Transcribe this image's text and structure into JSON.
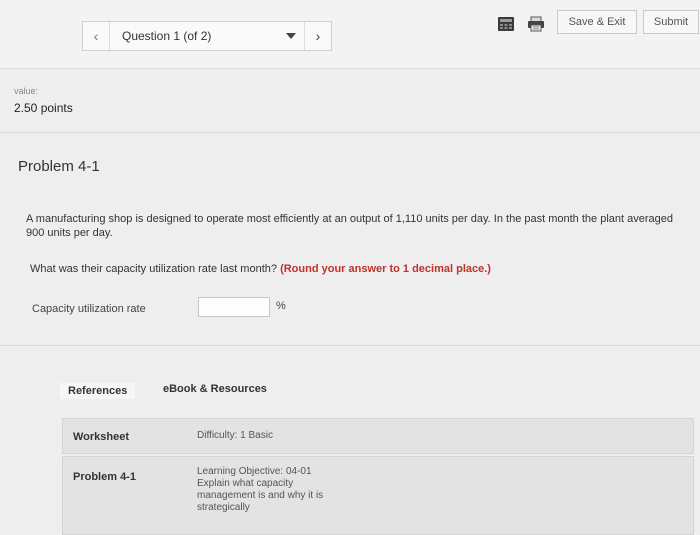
{
  "header": {
    "question_selector": "Question 1 (of 2)",
    "save_exit_label": "Save & Exit",
    "submit_label": "Submit",
    "icons": [
      "calculator-icon",
      "print-icon"
    ]
  },
  "score": {
    "label": "value:",
    "points": "2.50 points"
  },
  "problem": {
    "title": "Problem 4-1",
    "text": "A manufacturing shop is designed to operate most efficiently at an output of 1,110 units per day. In the past month the plant averaged 900 units per day.",
    "prompt": "What was their capacity utilization rate last month?",
    "hint": "(Round your answer to 1 decimal place.)",
    "input_label": "Capacity utilization rate",
    "input_value": "",
    "unit": "%"
  },
  "tabs": {
    "references": "References",
    "ebook": "eBook & Resources"
  },
  "rows": [
    {
      "name": "Worksheet",
      "info": "Difficulty: 1 Basic"
    },
    {
      "name": "Problem 4-1",
      "info": "Learning Objective: 04-01 Explain what capacity management is and why it is strategically"
    }
  ],
  "colors": {
    "hint": "#c0322b",
    "background": "#eeeeee"
  }
}
